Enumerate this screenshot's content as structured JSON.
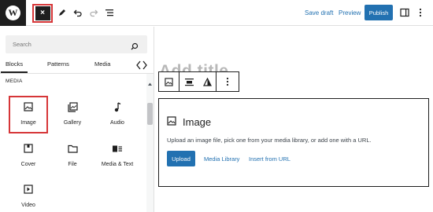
{
  "topbar": {
    "logo_letter": "W",
    "close_symbol": "×",
    "save_draft": "Save draft",
    "preview": "Preview",
    "publish": "Publish"
  },
  "inserter": {
    "search_placeholder": "Search",
    "tabs": [
      {
        "label": "Blocks",
        "active": true
      },
      {
        "label": "Patterns",
        "active": false
      },
      {
        "label": "Media",
        "active": false
      }
    ],
    "section_label": "MEDIA",
    "blocks": [
      {
        "label": "Image",
        "icon": "image-icon",
        "highlighted": true
      },
      {
        "label": "Gallery",
        "icon": "gallery-icon",
        "highlighted": false
      },
      {
        "label": "Audio",
        "icon": "audio-icon",
        "highlighted": false
      },
      {
        "label": "Cover",
        "icon": "cover-icon",
        "highlighted": false
      },
      {
        "label": "File",
        "icon": "file-icon",
        "highlighted": false
      },
      {
        "label": "Media & Text",
        "icon": "media-text-icon",
        "highlighted": false
      },
      {
        "label": "Video",
        "icon": "video-icon",
        "highlighted": false
      }
    ]
  },
  "editor": {
    "title_placeholder": "Add title",
    "image_block": {
      "title": "Image",
      "description": "Upload an image file, pick one from your media library, or add one with a URL.",
      "upload": "Upload",
      "media_library": "Media Library",
      "insert_from_url": "Insert from URL"
    }
  },
  "colors": {
    "accent": "#2271b1",
    "highlight": "#d63638",
    "dark": "#1e1e1e"
  }
}
